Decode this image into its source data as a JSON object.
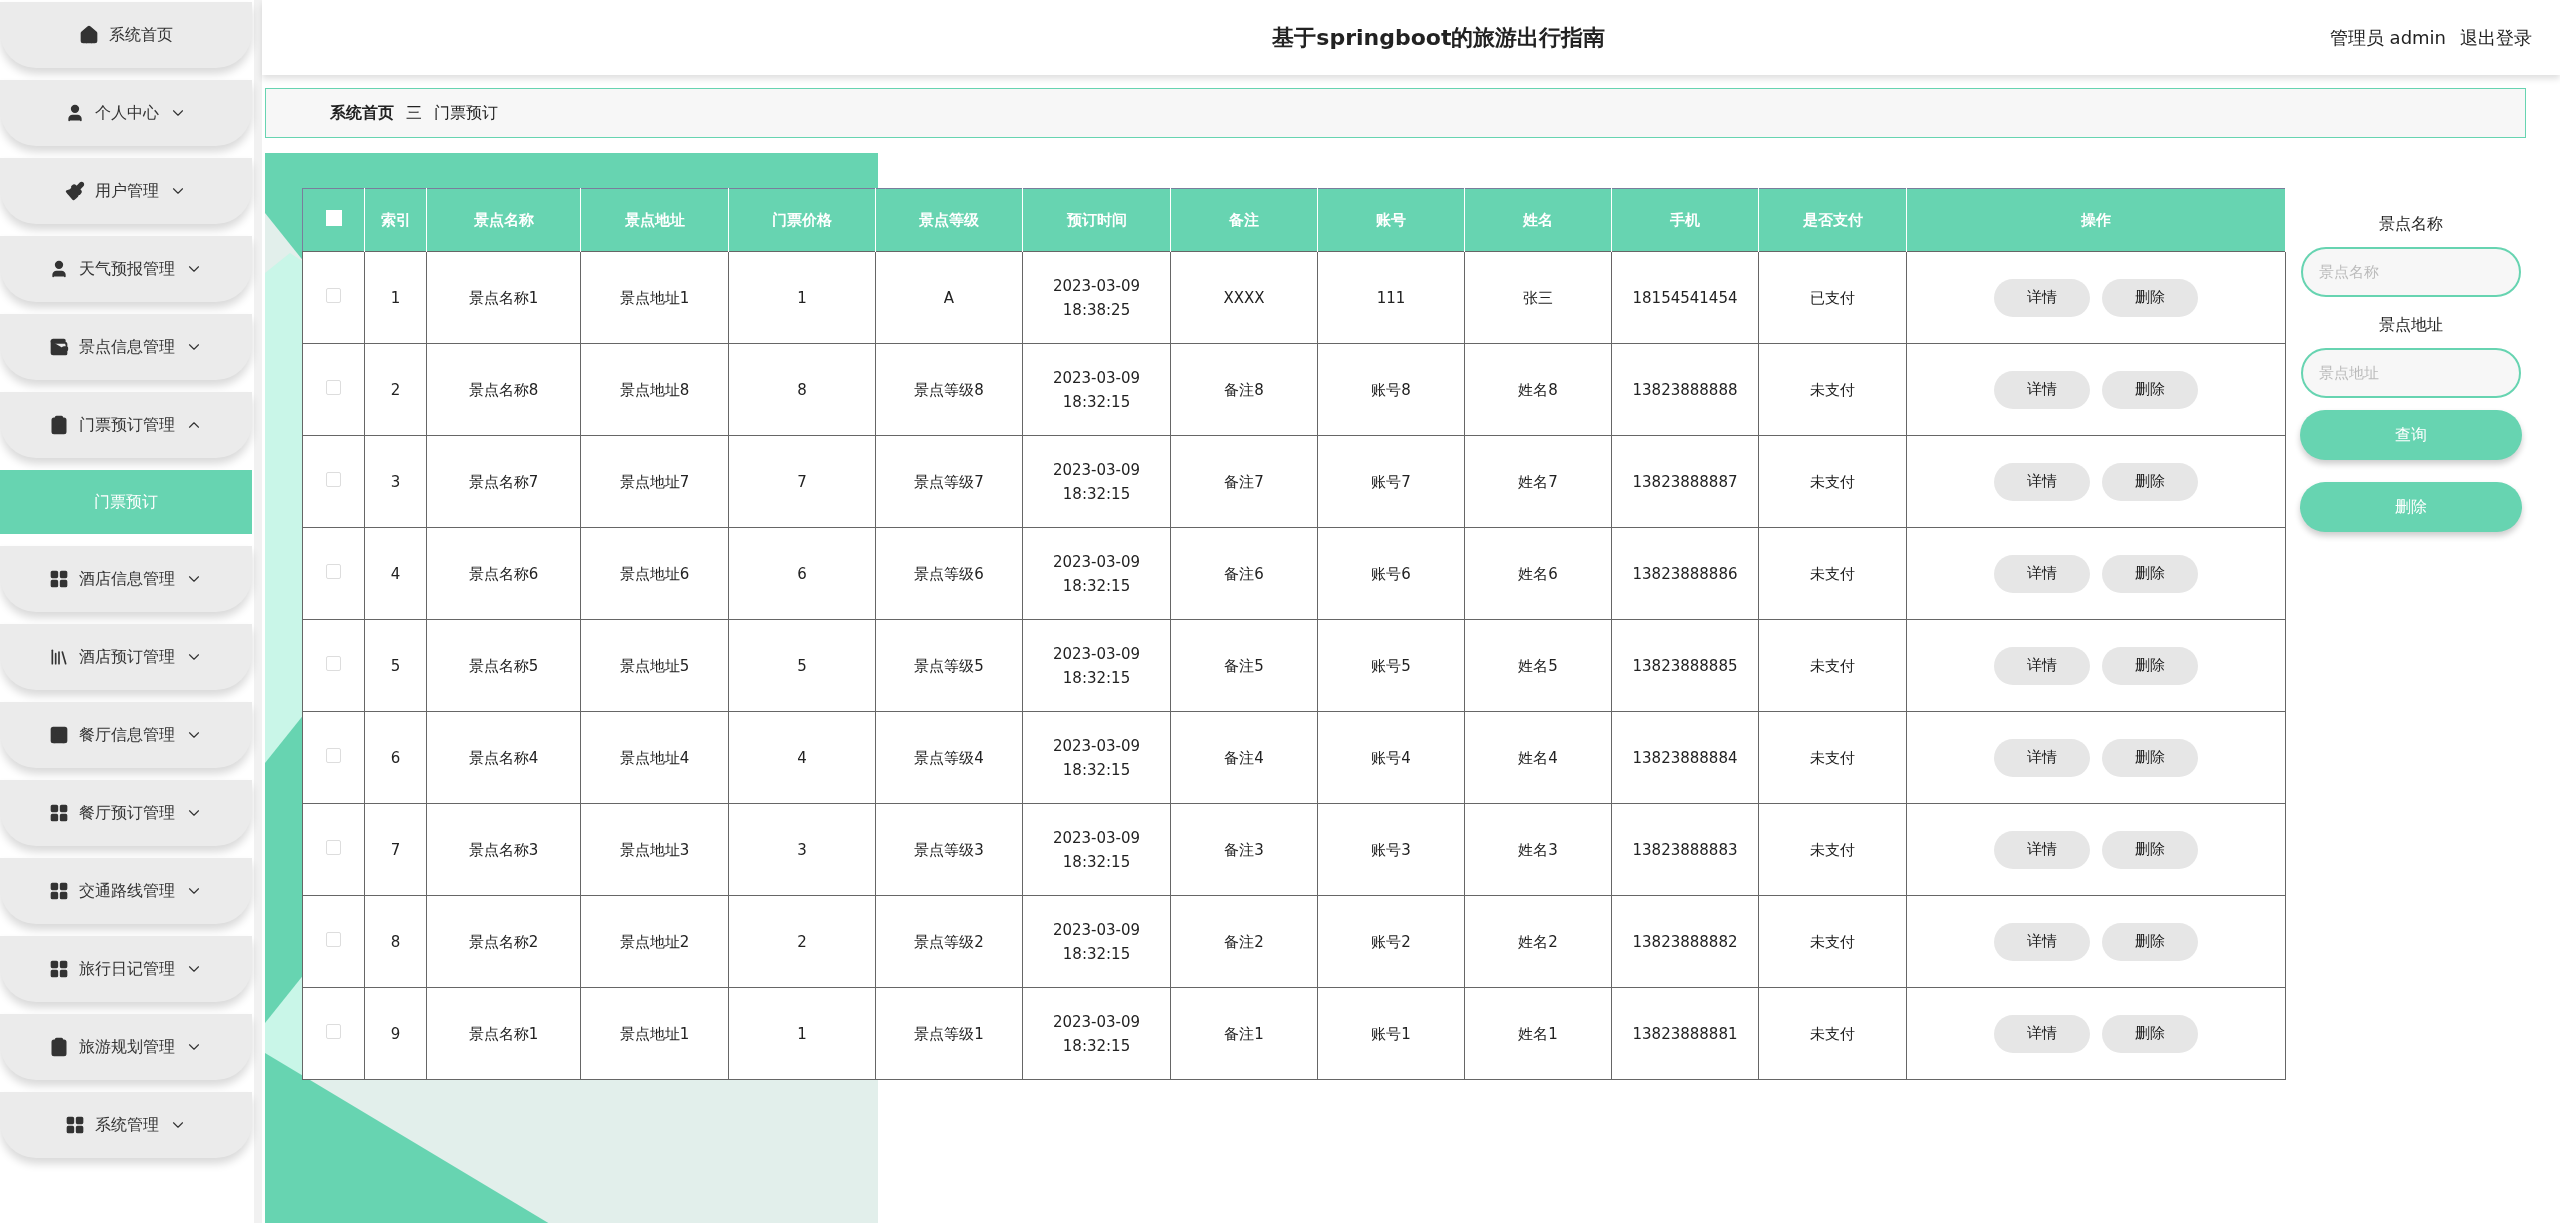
{
  "header": {
    "title": "基于springboot的旅游出行指南",
    "user": "管理员 admin",
    "logout": "退出登录"
  },
  "sidebar": {
    "items": [
      {
        "label": "系统首页"
      },
      {
        "label": "个人中心",
        "expanded": false
      },
      {
        "label": "用户管理",
        "expanded": false
      },
      {
        "label": "天气预报管理",
        "expanded": false
      },
      {
        "label": "景点信息管理",
        "expanded": false
      },
      {
        "label": "门票预订管理",
        "expanded": true,
        "children": [
          {
            "label": "门票预订",
            "selected": true
          }
        ]
      },
      {
        "label": "酒店信息管理",
        "expanded": false
      },
      {
        "label": "酒店预订管理",
        "expanded": false
      },
      {
        "label": "餐厅信息管理",
        "expanded": false
      },
      {
        "label": "餐厅预订管理",
        "expanded": false
      },
      {
        "label": "交通路线管理",
        "expanded": false
      },
      {
        "label": "旅行日记管理",
        "expanded": false
      },
      {
        "label": "旅游规划管理",
        "expanded": false
      },
      {
        "label": "系统管理",
        "expanded": false
      }
    ]
  },
  "breadcrumb": {
    "items": [
      "系统首页",
      "门票预订"
    ],
    "separator": "三"
  },
  "table": {
    "select_all": {
      "checked": false
    },
    "columns": [
      "索引",
      "景点名称",
      "景点地址",
      "门票价格",
      "景点等级",
      "预订时间",
      "备注",
      "账号",
      "姓名",
      "手机",
      "是否支付",
      "操作"
    ],
    "rows": [
      {
        "checked": false,
        "cells": [
          "1",
          "景点名称1",
          "景点地址1",
          "1",
          "A",
          "2023-03-09 18:38:25",
          "XXXX",
          "111",
          "张三",
          "18154541454",
          "已支付"
        ],
        "actions": [
          "详情",
          "删除"
        ]
      },
      {
        "checked": false,
        "cells": [
          "2",
          "景点名称8",
          "景点地址8",
          "8",
          "景点等级8",
          "2023-03-09 18:32:15",
          "备注8",
          "账号8",
          "姓名8",
          "13823888888",
          "未支付"
        ],
        "actions": [
          "详情",
          "删除"
        ]
      },
      {
        "checked": false,
        "cells": [
          "3",
          "景点名称7",
          "景点地址7",
          "7",
          "景点等级7",
          "2023-03-09 18:32:15",
          "备注7",
          "账号7",
          "姓名7",
          "13823888887",
          "未支付"
        ],
        "actions": [
          "详情",
          "删除"
        ]
      },
      {
        "checked": false,
        "cells": [
          "4",
          "景点名称6",
          "景点地址6",
          "6",
          "景点等级6",
          "2023-03-09 18:32:15",
          "备注6",
          "账号6",
          "姓名6",
          "13823888886",
          "未支付"
        ],
        "actions": [
          "详情",
          "删除"
        ]
      },
      {
        "checked": false,
        "cells": [
          "5",
          "景点名称5",
          "景点地址5",
          "5",
          "景点等级5",
          "2023-03-09 18:32:15",
          "备注5",
          "账号5",
          "姓名5",
          "13823888885",
          "未支付"
        ],
        "actions": [
          "详情",
          "删除"
        ]
      },
      {
        "checked": false,
        "cells": [
          "6",
          "景点名称4",
          "景点地址4",
          "4",
          "景点等级4",
          "2023-03-09 18:32:15",
          "备注4",
          "账号4",
          "姓名4",
          "13823888884",
          "未支付"
        ],
        "actions": [
          "详情",
          "删除"
        ]
      },
      {
        "checked": false,
        "cells": [
          "7",
          "景点名称3",
          "景点地址3",
          "3",
          "景点等级3",
          "2023-03-09 18:32:15",
          "备注3",
          "账号3",
          "姓名3",
          "13823888883",
          "未支付"
        ],
        "actions": [
          "详情",
          "删除"
        ]
      },
      {
        "checked": false,
        "cells": [
          "8",
          "景点名称2",
          "景点地址2",
          "2",
          "景点等级2",
          "2023-03-09 18:32:15",
          "备注2",
          "账号2",
          "姓名2",
          "13823888882",
          "未支付"
        ],
        "actions": [
          "详情",
          "删除"
        ]
      },
      {
        "checked": false,
        "cells": [
          "9",
          "景点名称1",
          "景点地址1",
          "1",
          "景点等级1",
          "2023-03-09 18:32:15",
          "备注1",
          "账号1",
          "姓名1",
          "13823888881",
          "未支付"
        ],
        "actions": [
          "详情",
          "删除"
        ]
      }
    ]
  },
  "search": {
    "fields": [
      {
        "label": "景点名称",
        "placeholder": "景点名称"
      },
      {
        "label": "景点地址",
        "placeholder": "景点地址"
      }
    ],
    "buttons": [
      "查询",
      "删除"
    ]
  }
}
